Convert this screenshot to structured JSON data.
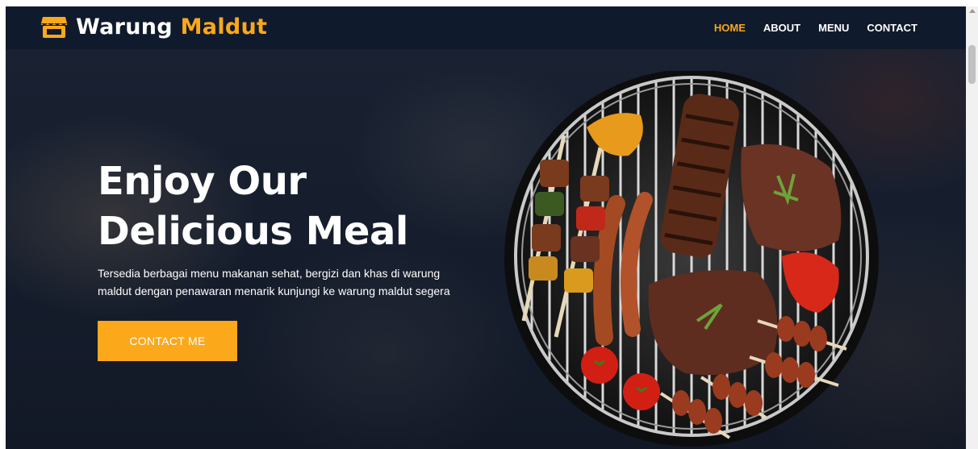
{
  "brand": {
    "name_part1": "Warung",
    "name_part2": "Maldut",
    "icon": "storefront-icon"
  },
  "nav": {
    "items": [
      {
        "label": "HOME",
        "active": true
      },
      {
        "label": "ABOUT",
        "active": false
      },
      {
        "label": "MENU",
        "active": false
      },
      {
        "label": "CONTACT",
        "active": false
      }
    ]
  },
  "hero": {
    "title_line1": "Enjoy Our",
    "title_line2": "Delicious Meal",
    "description": "Tersedia berbagai menu makanan sehat, bergizi dan khas di warung maldut dengan penawaran menarik kunjungi ke warung maldut segera",
    "cta_label": "CONTACT ME",
    "image_icon": "grilled-food-icon"
  },
  "colors": {
    "accent": "#fba81b",
    "navbar_bg": "#101a2d",
    "hero_bg": "#151d2c",
    "text": "#ffffff"
  }
}
